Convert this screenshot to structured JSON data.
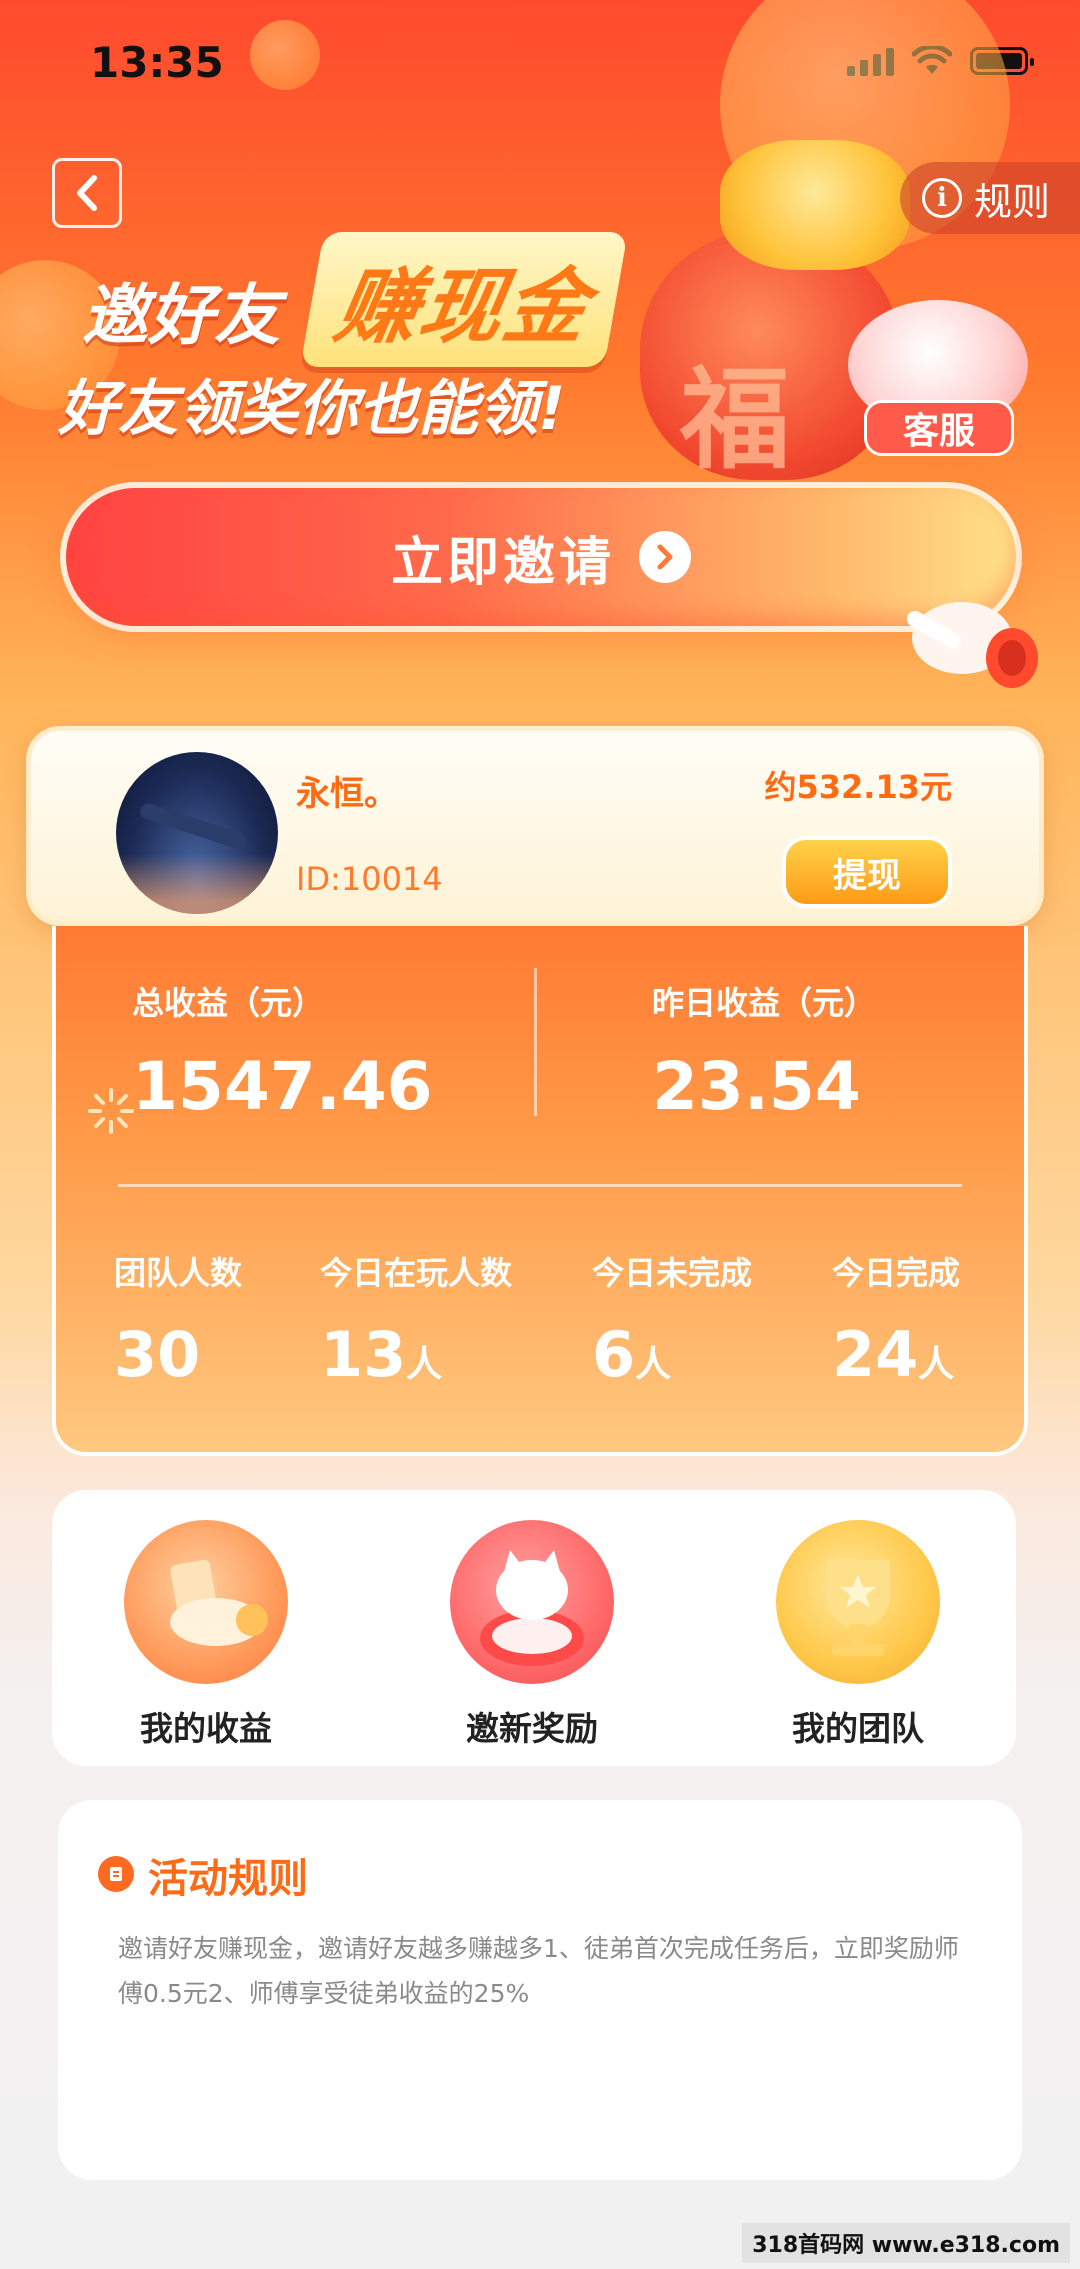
{
  "status_bar": {
    "time": "13:35"
  },
  "header": {
    "back_icon": "chevron-left-icon",
    "rules_label": "规则"
  },
  "banner": {
    "headline_prefix": "邀好友",
    "headline_highlight": "赚现金",
    "subheadline": "好友领奖你也能领!",
    "decor_char": "福",
    "service_label": "客服"
  },
  "invite": {
    "label": "立即邀请"
  },
  "user": {
    "name": "永恒。",
    "id": "ID:10014",
    "balance": "约532.13元",
    "withdraw_label": "提现"
  },
  "stats": {
    "total_label": "总收益（元）",
    "total_value": "1547.46",
    "yesterday_label": "昨日收益（元）",
    "yesterday_value": "23.54",
    "team": [
      {
        "label": "团队人数",
        "value": "30",
        "unit": ""
      },
      {
        "label": "今日在玩人数",
        "value": "13",
        "unit": "人"
      },
      {
        "label": "今日未完成",
        "value": "6",
        "unit": "人"
      },
      {
        "label": "今日完成",
        "value": "24",
        "unit": "人"
      }
    ]
  },
  "menu": [
    {
      "label": "我的收益",
      "icon": "whistle-icon"
    },
    {
      "label": "邀新奖励",
      "icon": "cat-donut-icon"
    },
    {
      "label": "我的团队",
      "icon": "trophy-icon"
    }
  ],
  "rules": {
    "title": "活动规则",
    "text": "邀请好友赚现金，邀请好友越多赚越多1、徒弟首次完成任务后，立即奖励师傅0.5元2、师傅享受徒弟收益的25%"
  },
  "watermark": "318首码网 www.e318.com",
  "colors": {
    "accent": "#ff6a16",
    "primary_red": "#ff4a2e",
    "gold": "#ffd24a"
  }
}
